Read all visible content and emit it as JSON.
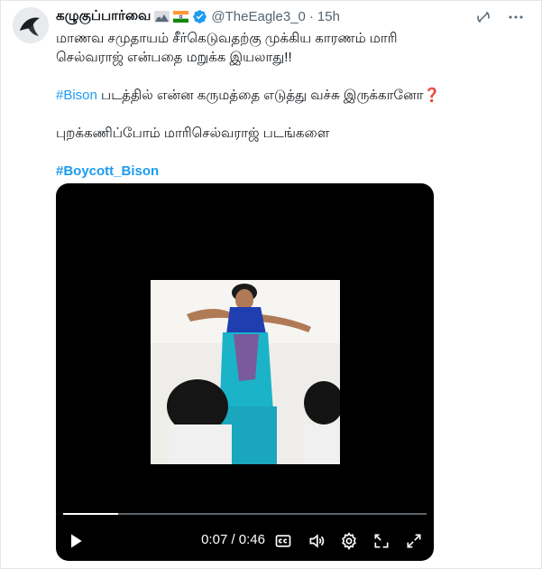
{
  "tweet": {
    "author_name": "கழுகுப்பார்வை",
    "handle": "@TheEagle3_0",
    "dot": "·",
    "time": "15h",
    "lines": {
      "l1": "மாணவ சமுதாயம் சீர்கெடுவதற்கு முக்கிய காரணம் மாரி",
      "l2": "செல்வராஜ் என்பதை மறுக்க இயலாது!!",
      "hashtag1": "#Bison",
      "l3_rest": " படத்தில் என்ன கருமத்தை எடுத்து வச்சு இருக்கானோ",
      "question_mark": "❓",
      "l4": "புறக்கணிப்போம் மாரிசெல்வராஜ் படங்களை",
      "hashtag2": "#Boycott_Bison"
    },
    "icons": {
      "avatar": "avatar",
      "flag1": "mountains-emoji",
      "flag2": "india-flag-emoji",
      "verified": "verified-badge-icon",
      "grok": "grok-icon",
      "more": "more-icon"
    }
  },
  "video": {
    "time_text": "0:07 / 0:46",
    "progress": 0.152,
    "icons": [
      "play-icon",
      "captions-icon",
      "volume-icon",
      "settings-icon",
      "pip-icon",
      "fullscreen-icon"
    ]
  },
  "colors": {
    "link": "#1d9bf0",
    "text": "#0f1419",
    "muted": "#536471",
    "accent_red": "#d9262c"
  }
}
